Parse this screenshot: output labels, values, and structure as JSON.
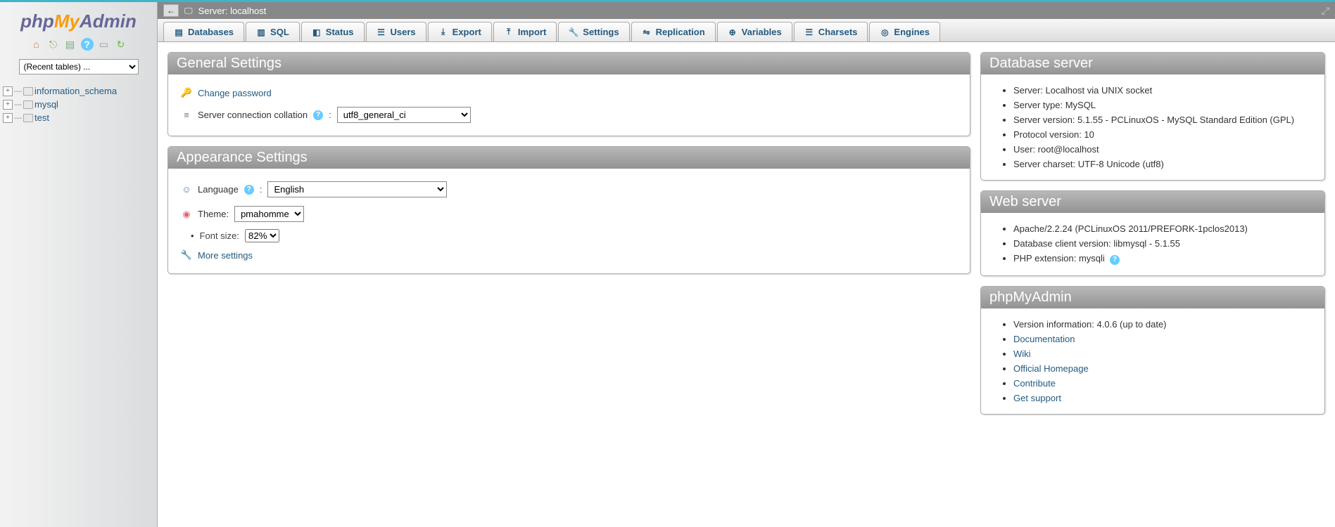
{
  "logo": {
    "php": "php",
    "my": "My",
    "admin": "Admin"
  },
  "sidebar": {
    "recent_placeholder": "(Recent tables) ...",
    "databases": [
      "information_schema",
      "mysql",
      "test"
    ]
  },
  "breadcrumb": {
    "label": "Server: localhost"
  },
  "tabs": [
    {
      "label": "Databases"
    },
    {
      "label": "SQL"
    },
    {
      "label": "Status"
    },
    {
      "label": "Users"
    },
    {
      "label": "Export"
    },
    {
      "label": "Import"
    },
    {
      "label": "Settings"
    },
    {
      "label": "Replication"
    },
    {
      "label": "Variables"
    },
    {
      "label": "Charsets"
    },
    {
      "label": "Engines"
    }
  ],
  "general": {
    "title": "General Settings",
    "change_password": "Change password",
    "collation_label": "Server connection collation",
    "collation_value": "utf8_general_ci"
  },
  "appearance": {
    "title": "Appearance Settings",
    "language_label": "Language",
    "language_value": "English",
    "theme_label": "Theme:",
    "theme_value": "pmahomme",
    "fontsize_label": "Font size:",
    "fontsize_value": "82%",
    "more_settings": "More settings"
  },
  "dbserver": {
    "title": "Database server",
    "items": [
      "Server: Localhost via UNIX socket",
      "Server type: MySQL",
      "Server version: 5.1.55 - PCLinuxOS - MySQL Standard Edition (GPL)",
      "Protocol version: 10",
      "User: root@localhost",
      "Server charset: UTF-8 Unicode (utf8)"
    ]
  },
  "webserver": {
    "title": "Web server",
    "items": [
      "Apache/2.2.24 (PCLinuxOS 2011/PREFORK-1pclos2013)",
      "Database client version: libmysql - 5.1.55",
      "PHP extension: mysqli"
    ]
  },
  "pma": {
    "title": "phpMyAdmin",
    "version": "Version information: 4.0.6 (up to date)",
    "links": [
      "Documentation",
      "Wiki",
      "Official Homepage",
      "Contribute",
      "Get support"
    ]
  }
}
